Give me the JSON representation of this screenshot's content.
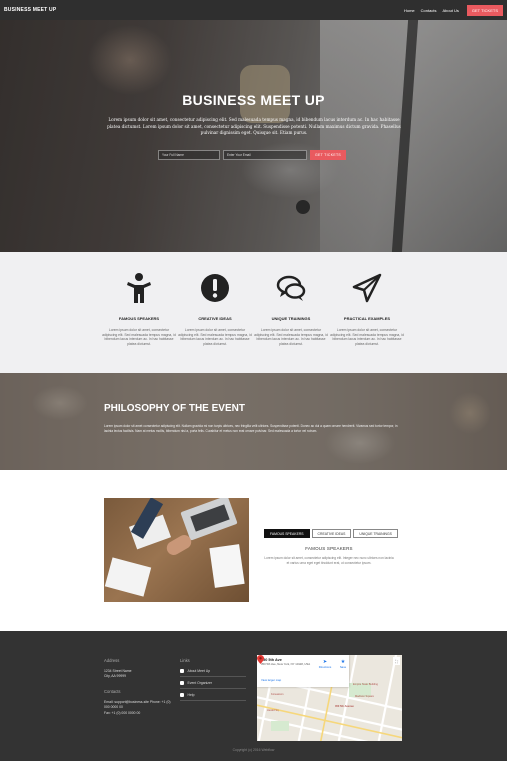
{
  "nav": {
    "brand": "BUSINESS MEET UP",
    "links": [
      "Home",
      "Contacts",
      "About Us"
    ],
    "cta": "GET TICKETS"
  },
  "hero": {
    "title": "BUSINESS MEET UP",
    "text": "Lorem ipsum dolor sit amet, consectetur adipiscing elit. Sed malesuada tempus magna, id bibendum lacus interdum ac. In hac habitasse platea dictumst. Lorem ipsum dolor sit amet, consectetur adipiscing elit. Suspendisse potenti. Nullam maximus dictum gravida. Phasellus pulvinar dignissim eget. Quisque sit. Etiam purus.",
    "name_placeholder": "Your Full Name",
    "email_placeholder": "Enter Your Email",
    "button": "GET TICKETS"
  },
  "features": [
    {
      "icon": "person-icon",
      "title": "FAMOUS SPEAKERS",
      "text": "Lorem ipsum dolor sit amet, consectetur adipiscing elit. Sed malesuada tempus magna, id bibendum lacus interdum ac. In hac habitasse platea dictumst."
    },
    {
      "icon": "exclamation-icon",
      "title": "CREATIVE IDEAS",
      "text": "Lorem ipsum dolor sit amet, consectetur adipiscing elit. Sed malesuada tempus magna, id bibendum lacus interdum ac. In hac habitasse platea dictumst."
    },
    {
      "icon": "chat-bubbles-icon",
      "title": "UNIQUE TRAININGS",
      "text": "Lorem ipsum dolor sit amet, consectetur adipiscing elit. Sed malesuada tempus magna, id bibendum lacus interdum ac. In hac habitasse platea dictumst."
    },
    {
      "icon": "paper-plane-icon",
      "title": "PRACTICAL EXAMPLES",
      "text": "Lorem ipsum dolor sit amet, consectetur adipiscing elit. Sed malesuada tempus magna, id bibendum lacus interdum ac. In hac habitasse platea dictumst."
    }
  ],
  "philosophy": {
    "title": "PHILOSOPHY OF THE EVENT",
    "text": "Lorem ipsum dolor sit amet consectetur adipiscing elit. Nullam gravida mi non turpis ultrices, nec fringilla velit ultrices. Suspendisse potenti. Donec ac dui a quam ornare hendrerit. Vivamus sed tortor tempor, in lacinia lectus facilisis. Nam at metus mollis, bibendum nisl a, porta felis. Curabitur et metus non erat ornare pulvinar. Sed malesuada a tortor vel rutrum."
  },
  "tabs": {
    "buttons": [
      "FAMOUS SPEAKERS",
      "CREATIVE IDEAS",
      "UNIQUE TRAININGS"
    ],
    "active_title": "FAMOUS SPEAKERS",
    "active_text": "Lorem ipsum dolor sit amet, consectetur adipiscing elit. Integer nec nunc ultrices non lacinia et varius urna eget eget tincidunt erat, ut consectetur ipsum."
  },
  "footer": {
    "address_heading": "Address",
    "address_lines": [
      "1234 Street Name",
      "City, AA 99999"
    ],
    "contacts_heading": "Contacts",
    "contact_lines": [
      "Email: support@business-site Phone: +1 (0) 000 0000 00",
      "Fax: +1 (0) 000 0000 00"
    ],
    "links_heading": "Links",
    "links": [
      "About Meet Up",
      "Event Organizer",
      "Help"
    ],
    "map": {
      "title": "350 5th Ave",
      "address": "350 5th Ave, New York, NY 10118, USA",
      "link": "View larger map",
      "actions": [
        "Directions",
        "Save"
      ],
      "labels": [
        "Empire State Building",
        "Madison Square",
        "Koreatown",
        "Herald Sq",
        "350 5th Avenue"
      ]
    },
    "copyright": "Copyright (c) 2016 Webflow"
  }
}
